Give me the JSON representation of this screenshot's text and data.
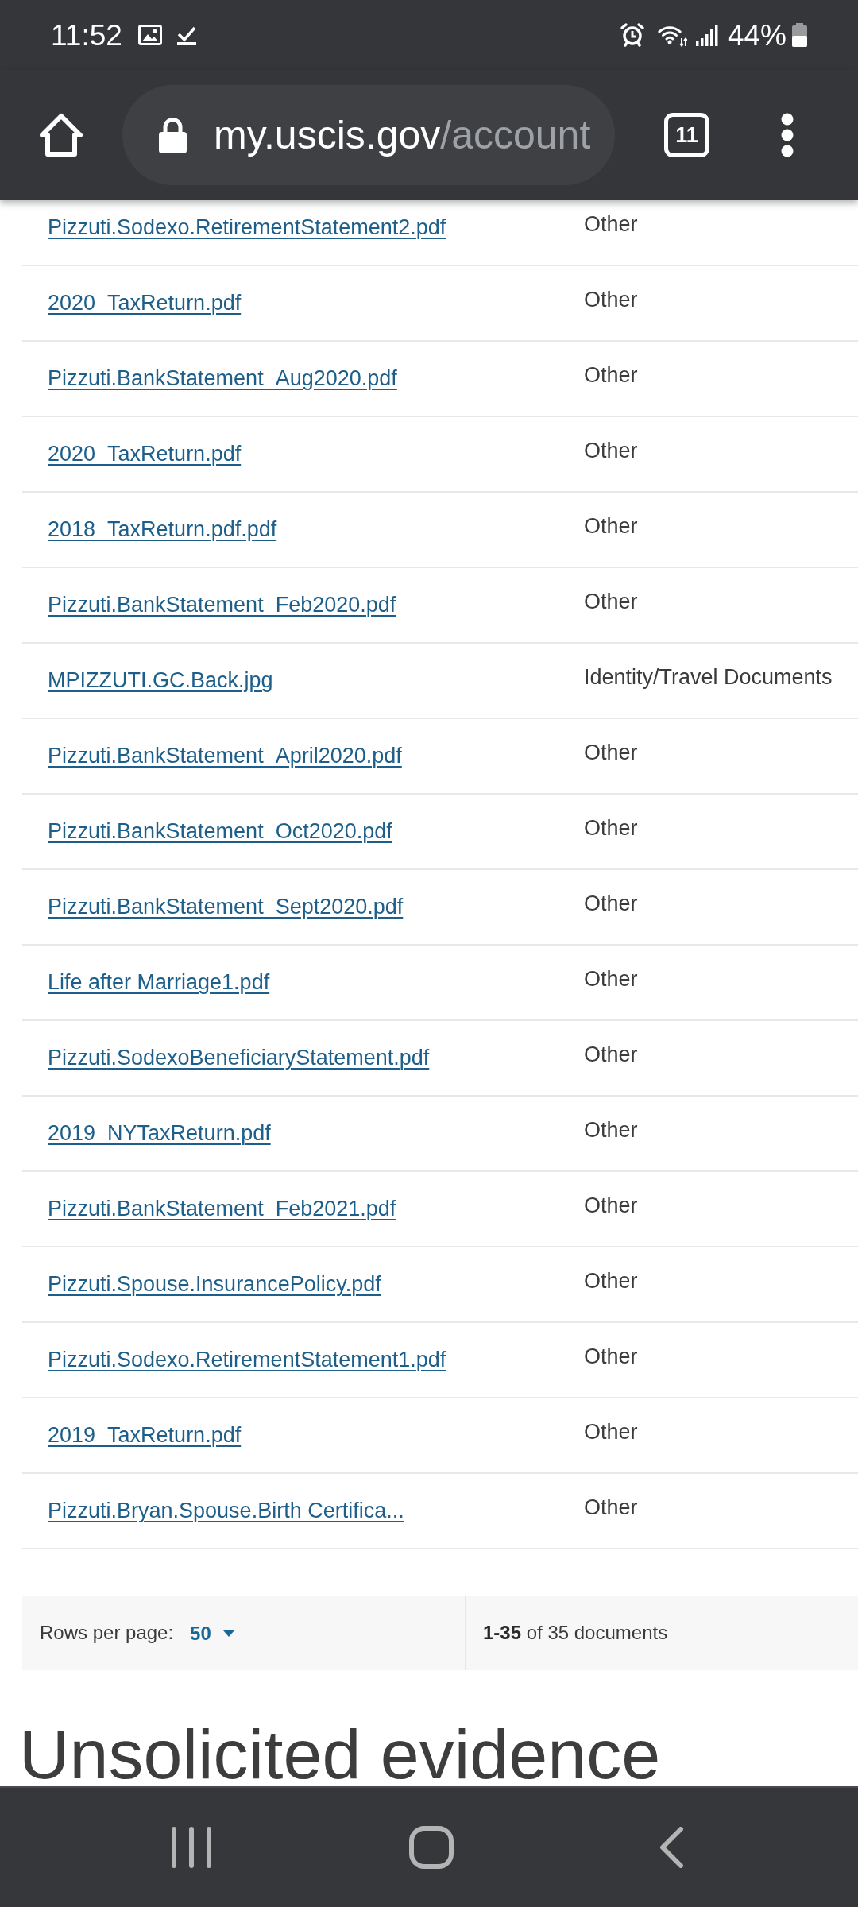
{
  "status_bar": {
    "time": "11:52",
    "battery": "44%"
  },
  "browser_toolbar": {
    "url_host": "my.uscis.gov",
    "url_path": "/account",
    "tab_count": "11"
  },
  "documents_table": {
    "rows": [
      {
        "column_1": "Pizzuti.Sodexo.RetirementStatement2.pdf",
        "column_2": "Other"
      },
      {
        "column_1": "2020_TaxReturn.pdf",
        "column_2": "Other"
      },
      {
        "column_1": "Pizzuti.BankStatement_Aug2020.pdf",
        "column_2": "Other"
      },
      {
        "column_1": "2020_TaxReturn.pdf",
        "column_2": "Other"
      },
      {
        "column_1": "2018_TaxReturn.pdf.pdf",
        "column_2": "Other"
      },
      {
        "column_1": "Pizzuti.BankStatement_Feb2020.pdf",
        "column_2": "Other"
      },
      {
        "column_1": "MPIZZUTI.GC.Back.jpg",
        "column_2": "Identity/Travel Documents"
      },
      {
        "column_1": "Pizzuti.BankStatement_April2020.pdf",
        "column_2": "Other"
      },
      {
        "column_1": "Pizzuti.BankStatement_Oct2020.pdf",
        "column_2": "Other"
      },
      {
        "column_1": "Pizzuti.BankStatement_Sept2020.pdf",
        "column_2": "Other"
      },
      {
        "column_1": "Life after Marriage1.pdf",
        "column_2": "Other"
      },
      {
        "column_1": "Pizzuti.SodexoBeneficiaryStatement.pdf",
        "column_2": "Other"
      },
      {
        "column_1": "2019_NYTaxReturn.pdf",
        "column_2": "Other"
      },
      {
        "column_1": "Pizzuti.BankStatement_Feb2021.pdf",
        "column_2": "Other"
      },
      {
        "column_1": "Pizzuti.Spouse.InsurancePolicy.pdf",
        "column_2": "Other"
      },
      {
        "column_1": "Pizzuti.Sodexo.RetirementStatement1.pdf",
        "column_2": "Other"
      },
      {
        "column_1": "2019_TaxReturn.pdf",
        "column_2": "Other"
      },
      {
        "column_1": "Pizzuti.Bryan.Spouse.Birth Certifica...",
        "column_2": "Other"
      }
    ]
  },
  "pagination": {
    "rows_per_page_label": "Rows per page:",
    "rows_per_page": "50",
    "summary": "**1-35** of 35 documents"
  },
  "section_heading": "Unsolicited evidence"
}
